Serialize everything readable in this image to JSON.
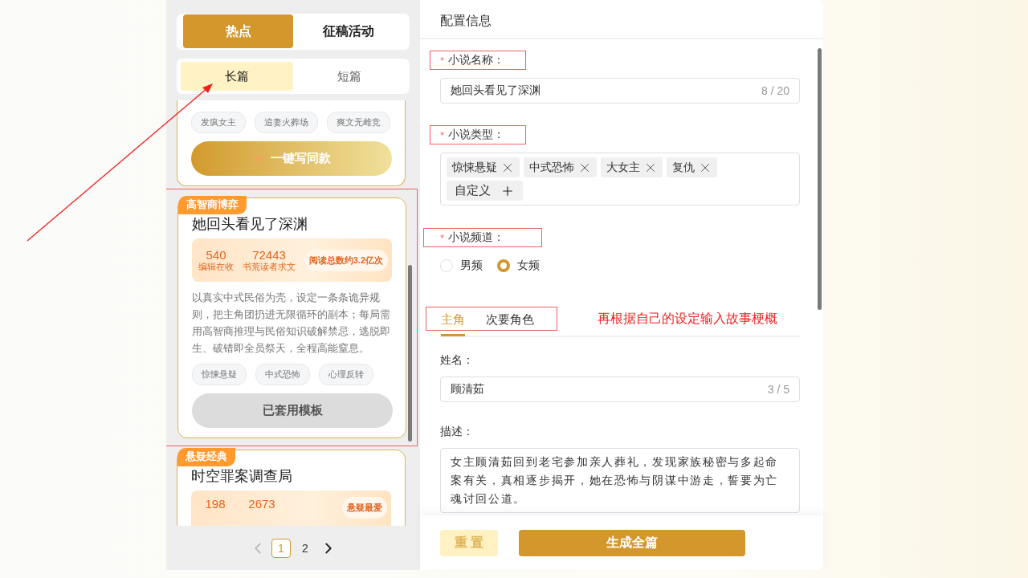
{
  "left_panel": {
    "category_tabs": [
      {
        "label": "热点",
        "selected": true
      },
      {
        "label": "征稿活动",
        "selected": false
      }
    ],
    "length_tabs": [
      {
        "label": "长篇",
        "selected": true
      },
      {
        "label": "短篇",
        "selected": false
      }
    ],
    "cards": [
      {
        "clipped_top": true,
        "tags": [
          "发疯女主",
          "追妻火葬场",
          "爽文无雌竞"
        ],
        "action": {
          "label": "一键写同款",
          "applied": false
        }
      },
      {
        "annotated": true,
        "badge": "高智商博弈",
        "title": "她回头看见了深渊",
        "stats": [
          {
            "value": "540",
            "label": "编辑在收"
          },
          {
            "value": "72443",
            "label": "书荒读者求文"
          }
        ],
        "highlight": "阅读总数约3.2亿次",
        "description": "以真实中式民俗为壳，设定一条条诡异规则，把主角团扔进无限循环的副本；每局需用高智商推理与民俗知识破解禁忌，逃脱即生、破错即全员祭天，全程高能窒息。",
        "tags": [
          "惊悚悬疑",
          "中式恐怖",
          "心理反转"
        ],
        "action": {
          "label": "已套用模板",
          "applied": true
        }
      },
      {
        "badge": "悬疑经典",
        "title": "时空罪案调查局",
        "stats": [
          {
            "value": "198"
          },
          {
            "value": "2673"
          }
        ],
        "highlight": "悬疑最爱"
      }
    ],
    "pagination": {
      "pages": [
        {
          "label": "1",
          "selected": true
        },
        {
          "label": "2",
          "selected": false
        }
      ]
    }
  },
  "config_panel": {
    "title": "配置信息",
    "fields": [
      {
        "kind": "text",
        "required_mark": "*",
        "label": "小说名称：",
        "annotated": true,
        "value": "她回头看见了深渊",
        "counter": "8 / 20"
      },
      {
        "kind": "tags",
        "required_mark": "*",
        "label": "小说类型：",
        "annotated": true,
        "tags": [
          "惊悚悬疑",
          "中式恐怖",
          "大女主",
          "复仇"
        ],
        "add_label": "自定义"
      },
      {
        "kind": "radio",
        "required_mark": "*",
        "label": "小说频道：",
        "annotated": true,
        "options": [
          {
            "label": "男频",
            "selected": false
          },
          {
            "label": "女频",
            "selected": true
          }
        ]
      }
    ],
    "role_tabs": {
      "annotated": true,
      "tabs": [
        {
          "label": "主角",
          "selected": true
        },
        {
          "label": "次要角色",
          "selected": false
        }
      ]
    },
    "annotation_note": "再根据自己的设定输入故事梗概",
    "role_fields": [
      {
        "kind": "text",
        "label": "姓名：",
        "value": "顾清茹",
        "counter": "3 / 5"
      },
      {
        "kind": "textarea",
        "label": "描述：",
        "value": "女主顾清茹回到老宅参加亲人葬礼，发现家族秘密与多起命案有关，真相逐步揭开，她在恐怖与阴谋中游走，誓要为亡魂讨回公道。"
      }
    ],
    "actions": [
      {
        "kind": "secondary",
        "label": "重 置"
      },
      {
        "kind": "primary",
        "label": "生成全篇"
      }
    ]
  }
}
